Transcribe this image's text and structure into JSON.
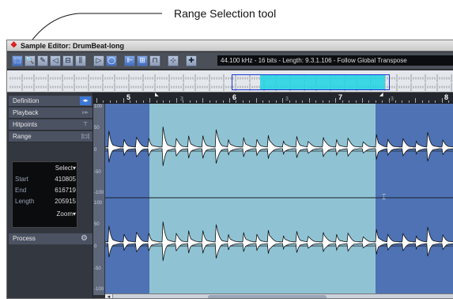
{
  "callout": {
    "label": "Range Selection tool"
  },
  "window": {
    "title": "Sample Editor: DrumBeat-long"
  },
  "toolbar": {
    "info": "44.100 kHz - 16 bits - Length: 9.3.1.106 - Follow Global Transpose",
    "tools": [
      {
        "name": "range-selection-tool",
        "glyph": "⬚",
        "active": true
      },
      {
        "name": "zoom-tool",
        "glyph": "🔍"
      },
      {
        "name": "draw-tool",
        "glyph": "✎"
      },
      {
        "name": "play-tool",
        "glyph": "◁"
      },
      {
        "name": "hitpoint-tool",
        "glyph": "⊟"
      },
      {
        "name": "warp-tool",
        "glyph": "⫼"
      },
      {
        "name": "play-button",
        "glyph": "▷"
      },
      {
        "name": "loop-button",
        "glyph": "◯",
        "active": true
      },
      {
        "name": "snap-button",
        "glyph": "⊩",
        "active": true
      },
      {
        "name": "snap-zero-button",
        "glyph": "⊞",
        "active": true
      },
      {
        "name": "autoscroll-button",
        "glyph": "⊓"
      },
      {
        "name": "levels-button",
        "glyph": "⊹"
      },
      {
        "name": "cross-button",
        "glyph": "✚"
      }
    ]
  },
  "sidebar": {
    "items": [
      {
        "label": "Definition",
        "icon": "range-icon"
      },
      {
        "label": "Playback",
        "icon": "playback-icon"
      },
      {
        "label": "Hitpoints",
        "icon": "hitpoint-icon"
      },
      {
        "label": "Range",
        "icon": "range-bars-icon"
      }
    ],
    "selection": {
      "mode": "Select",
      "start_label": "Start",
      "start": "410805",
      "end_label": "End",
      "end": "616719",
      "length_label": "Length",
      "length": "205915",
      "zoom": "Zoom"
    },
    "process": {
      "label": "Process"
    }
  },
  "ruler": {
    "bars": [
      "5",
      "6",
      "7",
      "8"
    ],
    "beats": [
      "3",
      "3",
      "3"
    ]
  },
  "scale": {
    "labels": [
      "100",
      "50",
      "0",
      "-50",
      "-100",
      "100",
      "50",
      "0",
      "-50",
      "-100"
    ]
  }
}
